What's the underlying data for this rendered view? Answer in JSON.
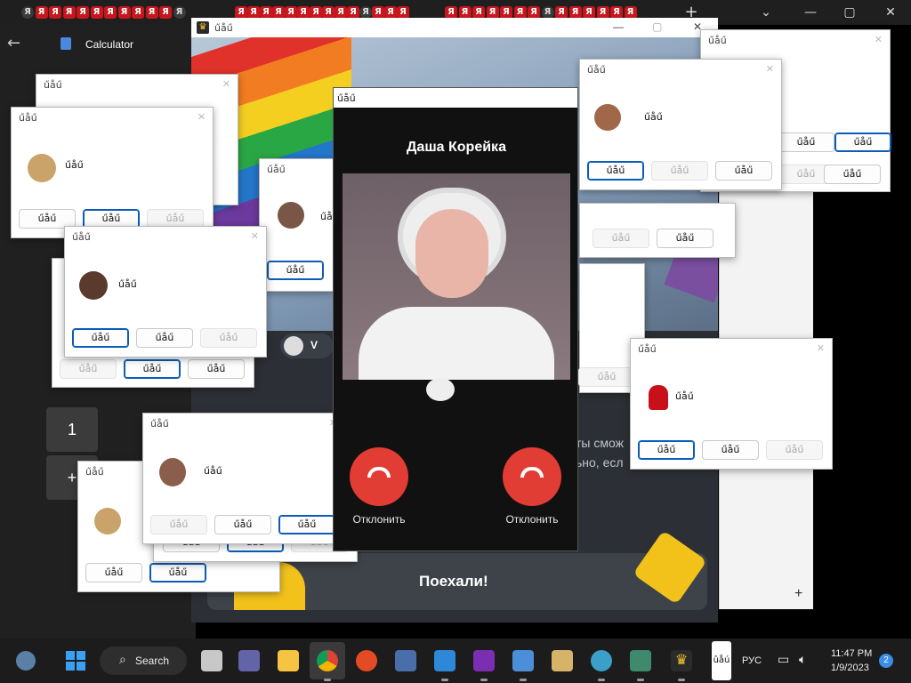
{
  "browser": {
    "tab_glyph": "Я",
    "window_controls": {
      "dropdown": "⌄",
      "minimize": "—",
      "maximize": "▢",
      "close": "✕"
    },
    "new_tab": "+"
  },
  "calculator": {
    "title": "Calculator",
    "key_one": "1",
    "key_plus": "+"
  },
  "main_window": {
    "title": "űåű",
    "bottom_button": "Поехали!",
    "snippet_line1": "ты смож",
    "snippet_line2": "ьно, есл",
    "chat_name": "V"
  },
  "call": {
    "window_title": "űåű",
    "caller_name": "Даша Корейка",
    "decline_left": "Отклонить",
    "decline_right": "Отклонить"
  },
  "dialogs": {
    "title": "űåű",
    "message": "űåű",
    "button_label": "űåű"
  },
  "taskbar": {
    "search_label": "Search",
    "pinned_text": "ûåú",
    "language": "РУС",
    "time": "11:47 PM",
    "date": "1/9/2023",
    "notification_count": "2"
  },
  "colors": {
    "decline_red": "#e23d35",
    "accent_blue": "#0a5cb8"
  }
}
